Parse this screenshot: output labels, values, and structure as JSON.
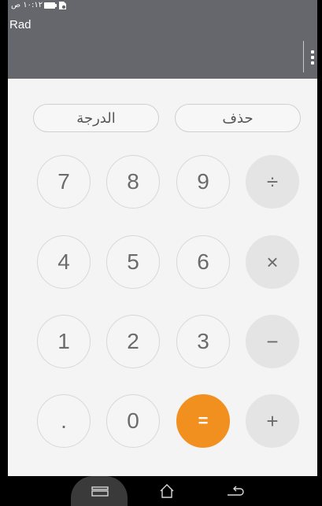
{
  "status": {
    "time": "١٠:١٢ ص"
  },
  "header": {
    "mode_label": "Rad"
  },
  "functions": {
    "clear_label": "حذف",
    "angle_unit_label": "الدرجة"
  },
  "keys": {
    "k7": "7",
    "k8": "8",
    "k9": "9",
    "divide": "÷",
    "k4": "4",
    "k5": "5",
    "k6": "6",
    "multiply": "×",
    "k1": "1",
    "k2": "2",
    "k3": "3",
    "minus": "−",
    "dot": ".",
    "k0": "0",
    "equals": "=",
    "plus": "+"
  },
  "colors": {
    "accent": "#f2901f",
    "header_bg": "#66676d"
  },
  "navigation": {
    "icons": [
      "recent-apps-icon",
      "home-icon",
      "back-icon"
    ]
  }
}
